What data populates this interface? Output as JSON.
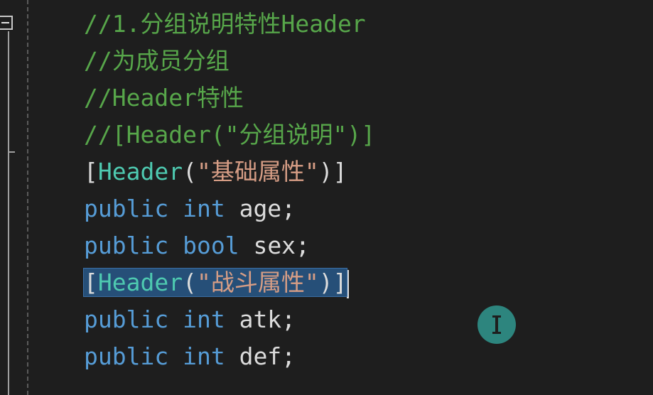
{
  "editor": {
    "lines": [
      {
        "tokens": [
          {
            "type": "comment",
            "text": "//1.分组说明特性Header"
          }
        ]
      },
      {
        "tokens": [
          {
            "type": "comment",
            "text": "//为成员分组"
          }
        ]
      },
      {
        "tokens": [
          {
            "type": "comment",
            "text": "//Header特性"
          }
        ]
      },
      {
        "tokens": [
          {
            "type": "comment",
            "text": "//[Header(\"分组说明\")]"
          }
        ]
      },
      {
        "tokens": [
          {
            "type": "plain",
            "text": "["
          },
          {
            "type": "type",
            "text": "Header"
          },
          {
            "type": "plain",
            "text": "("
          },
          {
            "type": "string",
            "text": "\"基础属性\""
          },
          {
            "type": "plain",
            "text": ")]"
          }
        ]
      },
      {
        "tokens": [
          {
            "type": "keyword",
            "text": "public"
          },
          {
            "type": "plain",
            "text": " "
          },
          {
            "type": "keyword",
            "text": "int"
          },
          {
            "type": "plain",
            "text": " age;"
          }
        ]
      },
      {
        "tokens": [
          {
            "type": "keyword",
            "text": "public"
          },
          {
            "type": "plain",
            "text": " "
          },
          {
            "type": "keyword",
            "text": "bool"
          },
          {
            "type": "plain",
            "text": " sex;"
          }
        ]
      },
      {
        "selected": true,
        "tokens": [
          {
            "type": "plain",
            "text": "["
          },
          {
            "type": "type",
            "text": "Header"
          },
          {
            "type": "plain",
            "text": "("
          },
          {
            "type": "string",
            "text": "\"战斗属性\""
          },
          {
            "type": "plain",
            "text": ")]"
          }
        ]
      },
      {
        "tokens": [
          {
            "type": "keyword",
            "text": "public"
          },
          {
            "type": "plain",
            "text": " "
          },
          {
            "type": "keyword",
            "text": "int"
          },
          {
            "type": "plain",
            "text": " atk;"
          }
        ]
      },
      {
        "tokens": [
          {
            "type": "keyword",
            "text": "public"
          },
          {
            "type": "plain",
            "text": " "
          },
          {
            "type": "keyword",
            "text": "int"
          },
          {
            "type": "plain",
            "text": " def;"
          }
        ]
      }
    ]
  },
  "colors": {
    "background": "#1e1e1e",
    "comment": "#57a64a",
    "keyword": "#569cd6",
    "type": "#4ec9b0",
    "string": "#d69d85",
    "plain": "#dcdcdc",
    "selection": "#264f78",
    "cursor_indicator": "#2e8b84"
  },
  "icons": {
    "fold": "collapse-icon",
    "cursor": "text-cursor-icon"
  }
}
